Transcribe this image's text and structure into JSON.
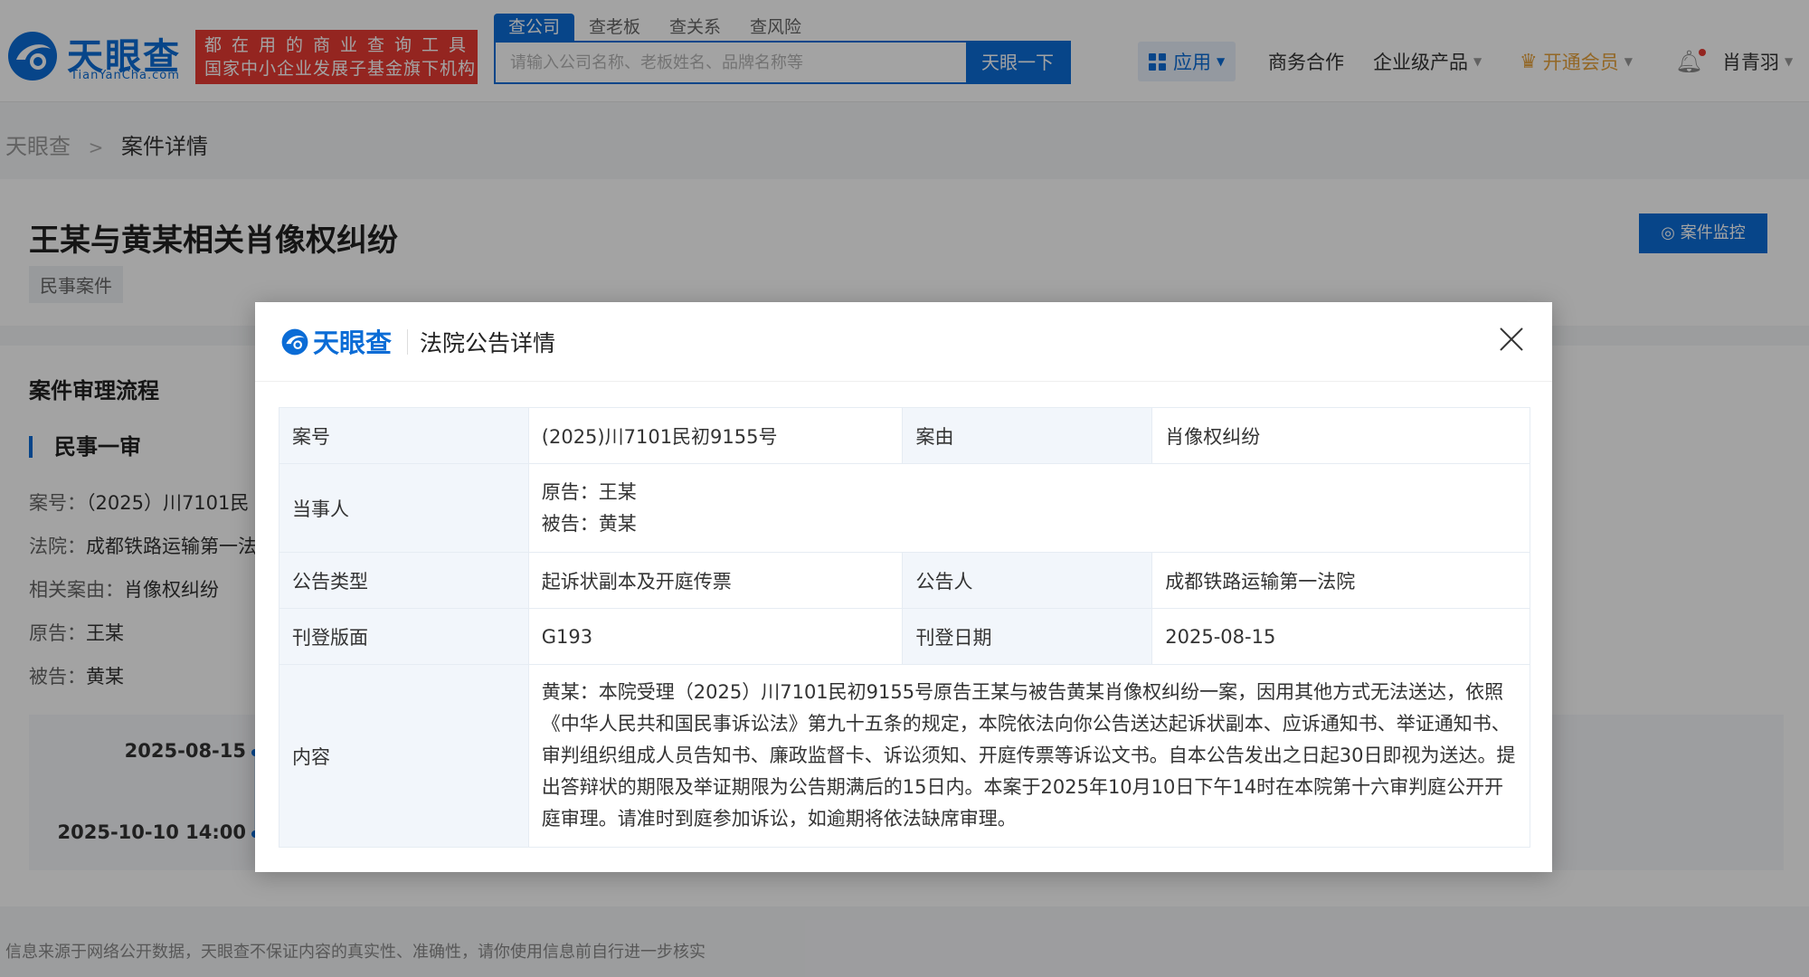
{
  "header": {
    "logo_text": "天眼查",
    "logo_sub": "TianYanCha.com",
    "slogan_line1": "都在用的商业查询工具",
    "slogan_line2": "国家中小企业发展子基金旗下机构",
    "search_tabs": [
      "查公司",
      "查老板",
      "查关系",
      "查风险"
    ],
    "search_placeholder": "请输入公司名称、老板姓名、品牌名称等",
    "search_button": "天眼一下",
    "nav_apps": "应用",
    "nav_business": "商务合作",
    "nav_enterprise": "企业级产品",
    "nav_vip": "开通会员",
    "nav_user": "肖青羽"
  },
  "breadcrumb": {
    "home": "天眼查",
    "current": "案件详情"
  },
  "case": {
    "title": "王某与黄某相关肖像权纠纷",
    "tag": "民事案件",
    "monitor_button": "案件监控"
  },
  "process": {
    "title": "案件审理流程",
    "stage": "民事一审",
    "fields": [
      {
        "label": "案号：",
        "value": "（2025）川7101民"
      },
      {
        "label": "法院：",
        "value": "成都铁路运输第一法"
      },
      {
        "label": "相关案由：",
        "value": "肖像权纠纷"
      },
      {
        "label": "原告：",
        "value": "王某"
      },
      {
        "label": "被告：",
        "value": "黄某"
      }
    ],
    "timeline": [
      "2025-08-15",
      "2025-10-10 14:00"
    ]
  },
  "footer_note": "信息来源于网络公开数据，天眼查不保证内容的真实性、准确性，请你使用信息前自行进一步核实",
  "modal": {
    "logo_text": "天眼查",
    "title": "法院公告详情",
    "rows": {
      "case_no_label": "案号",
      "case_no": "(2025)川7101民初9155号",
      "cause_label": "案由",
      "cause": "肖像权纠纷",
      "parties_label": "当事人",
      "plaintiff": "原告：王某",
      "defendant": "被告：黄某",
      "type_label": "公告类型",
      "type": "起诉状副本及开庭传票",
      "announcer_label": "公告人",
      "announcer": "成都铁路运输第一法院",
      "page_label": "刊登版面",
      "page": "G193",
      "date_label": "刊登日期",
      "date": "2025-08-15",
      "content_label": "内容",
      "content": "黄某：本院受理（2025）川7101民初9155号原告王某与被告黄某肖像权纠纷一案，因用其他方式无法送达，依照《中华人民共和国民事诉讼法》第九十五条的规定，本院依法向你公告送达起诉状副本、应诉通知书、举证通知书、审判组织组成人员告知书、廉政监督卡、诉讼须知、开庭传票等诉讼文书。自本公告发出之日起30日即视为送达。提出答辩状的期限及举证期限为公告期满后的15日内。本案于2025年10月10日下午14时在本院第十六审判庭公开开庭审理。请准时到庭参加诉讼，如逾期将依法缺席审理。"
    }
  }
}
